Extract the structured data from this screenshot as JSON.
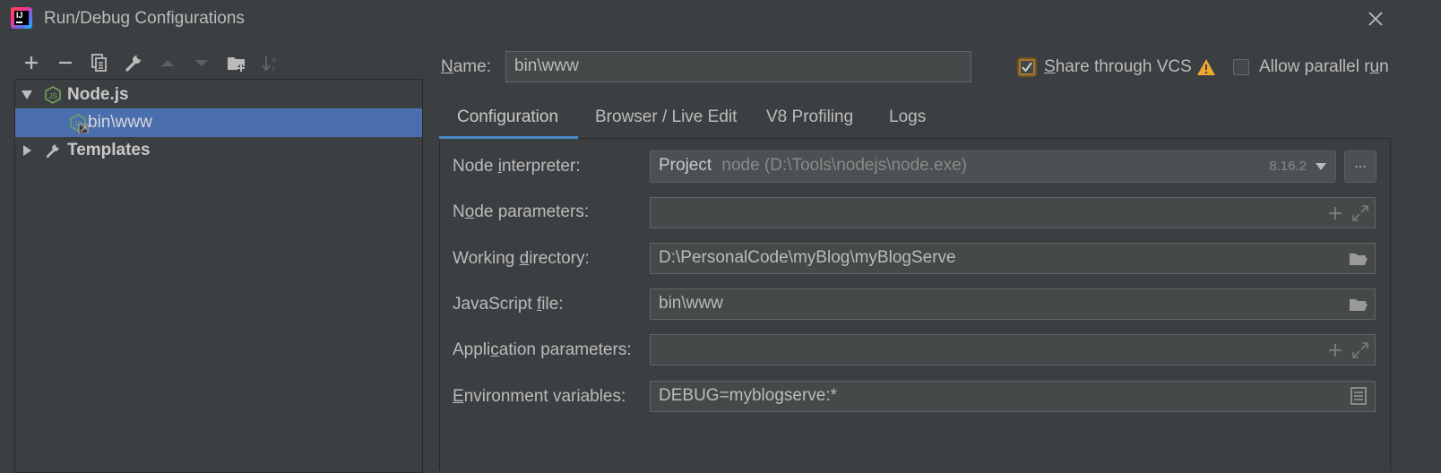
{
  "window": {
    "title": "Run/Debug Configurations",
    "logo_text": "IJ"
  },
  "tree": {
    "items": [
      {
        "label": "Node.js",
        "expanded": true
      },
      {
        "label": "bin\\www",
        "selected": true
      },
      {
        "label": "Templates",
        "expanded": false
      }
    ]
  },
  "name_field": {
    "label_u": "N",
    "label_rest": "ame:",
    "value": "bin\\www"
  },
  "share_vcs": {
    "label_u": "S",
    "label_rest": "hare through VCS",
    "checked": true
  },
  "parallel": {
    "label_pre": "Allow parallel r",
    "label_u": "u",
    "label_post": "n",
    "checked": false
  },
  "tabs": [
    {
      "label": "Configuration",
      "active": true
    },
    {
      "label": "Browser / Live Edit"
    },
    {
      "label": "V8 Profiling"
    },
    {
      "label": "Logs"
    }
  ],
  "form": {
    "interpreter": {
      "label_pre": "Node ",
      "label_u": "i",
      "label_post": "nterpreter:",
      "project": "Project",
      "path": "node (D:\\Tools\\nodejs\\node.exe)",
      "version": "8.16.2",
      "browse": "..."
    },
    "node_params": {
      "label_pre": "N",
      "label_u": "o",
      "label_post": "de parameters:",
      "value": ""
    },
    "working_dir": {
      "label_pre": "Working ",
      "label_u": "d",
      "label_post": "irectory:",
      "value": "D:\\PersonalCode\\myBlog\\myBlogServe"
    },
    "js_file": {
      "label_pre": "JavaScript ",
      "label_u": "f",
      "label_post": "ile:",
      "value": "bin\\www"
    },
    "app_params": {
      "label_pre": "Appli",
      "label_u": "c",
      "label_post": "ation parameters:",
      "value": ""
    },
    "env_vars": {
      "label_pre": "",
      "label_u": "E",
      "label_post": "nvironment variables:",
      "value": "DEBUG=myblogserve:*"
    }
  },
  "colors": {
    "background": "#3c3f41",
    "selection": "#4b6eaf",
    "tab_underline": "#4a88c7",
    "warning": "#f0a732",
    "node_green": "#6fa35a"
  }
}
